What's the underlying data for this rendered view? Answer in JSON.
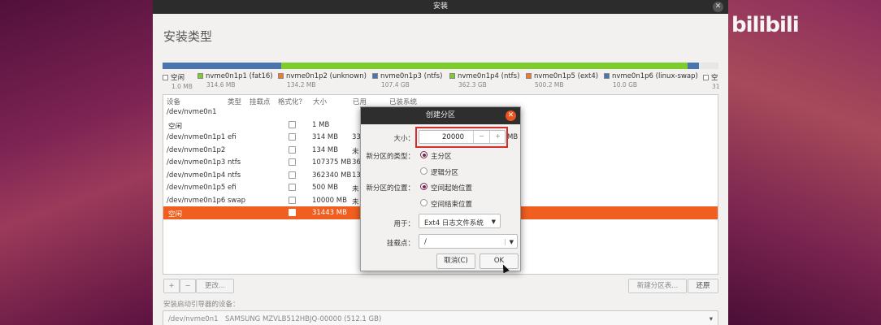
{
  "window": {
    "title": "安装",
    "close_icon": "close-icon",
    "page_title": "安装类型"
  },
  "watermark": {
    "brand": "bilibili"
  },
  "disk_bar": {
    "segments": [
      {
        "color": "#4a74ad",
        "fraction": 0.213
      },
      {
        "color": "#7ecb2c",
        "fraction": 0.732
      },
      {
        "color": "#4a74ad",
        "fraction": 0.02
      },
      {
        "color": "#e7e7e7",
        "fraction": 0.035
      }
    ]
  },
  "legend": [
    {
      "name": "空闲",
      "size": "1.0 MB",
      "color": "#ffffff"
    },
    {
      "name": "nvme0n1p1 (fat16)",
      "size": "314.6 MB",
      "color": "#7ecb2c"
    },
    {
      "name": "nvme0n1p2 (unknown)",
      "size": "134.2 MB",
      "color": "#ef7b2a"
    },
    {
      "name": "nvme0n1p3 (ntfs)",
      "size": "107.4 GB",
      "color": "#4a74ad"
    },
    {
      "name": "nvme0n1p4 (ntfs)",
      "size": "362.3 GB",
      "color": "#7ecb2c"
    },
    {
      "name": "nvme0n1p5 (ext4)",
      "size": "500.2 MB",
      "color": "#ef7b2a"
    },
    {
      "name": "nvme0n1p6 (linux-swap)",
      "size": "10.0 GB",
      "color": "#4a74ad"
    },
    {
      "name": "空",
      "size": "31",
      "color": "#ffffff"
    }
  ],
  "table": {
    "headers": {
      "device": "设备",
      "type": "类型",
      "mount": "挂载点",
      "format": "格式化？",
      "size": "大小",
      "used": "已用",
      "system": "已装系统"
    },
    "rows": [
      {
        "device": "/dev/nvme0n1",
        "type": "",
        "size": "",
        "used": "",
        "checkbox": false
      },
      {
        "device": "空闲",
        "type": "",
        "size": "1 MB",
        "used": "",
        "checkbox": true
      },
      {
        "device": "/dev/nvme0n1p1",
        "type": "efi",
        "size": "314 MB",
        "used": "33",
        "checkbox": true
      },
      {
        "device": "/dev/nvme0n1p2",
        "type": "",
        "size": "134 MB",
        "used": "未",
        "checkbox": true
      },
      {
        "device": "/dev/nvme0n1p3",
        "type": "ntfs",
        "size": "107375 MB",
        "used": "36",
        "checkbox": true
      },
      {
        "device": "/dev/nvme0n1p4",
        "type": "ntfs",
        "size": "362340 MB",
        "used": "13",
        "checkbox": true
      },
      {
        "device": "/dev/nvme0n1p5",
        "type": "efi",
        "size": "500 MB",
        "used": "未",
        "checkbox": true
      },
      {
        "device": "/dev/nvme0n1p6",
        "type": "swap",
        "size": "10000 MB",
        "used": "未",
        "checkbox": true
      },
      {
        "device": "空闲",
        "type": "",
        "size": "31443 MB",
        "used": "",
        "checkbox": true,
        "selected": true
      }
    ]
  },
  "buttons": {
    "add": "+",
    "remove": "−",
    "change": "更改...",
    "new_table": "新建分区表...",
    "revert": "还原"
  },
  "boot": {
    "label": "安装启动引导器的设备：",
    "device": "/dev/nvme0n1",
    "model": "SAMSUNG MZVLB512HBJQ-00000 (512.1 GB)"
  },
  "dialog": {
    "title": "创建分区",
    "size_label": "大小：",
    "size_value": "20000",
    "minus": "−",
    "plus": "+",
    "unit": "MB",
    "type_label": "新分区的类型：",
    "type_primary": "主分区",
    "type_logical": "逻辑分区",
    "location_label": "新分区的位置：",
    "location_start": "空间起始位置",
    "location_end": "空间结束位置",
    "use_label": "用于：",
    "use_value": "Ext4 日志文件系统",
    "mount_label": "挂载点：",
    "mount_value": "/",
    "cancel": "取消(C)",
    "ok": "OK"
  }
}
